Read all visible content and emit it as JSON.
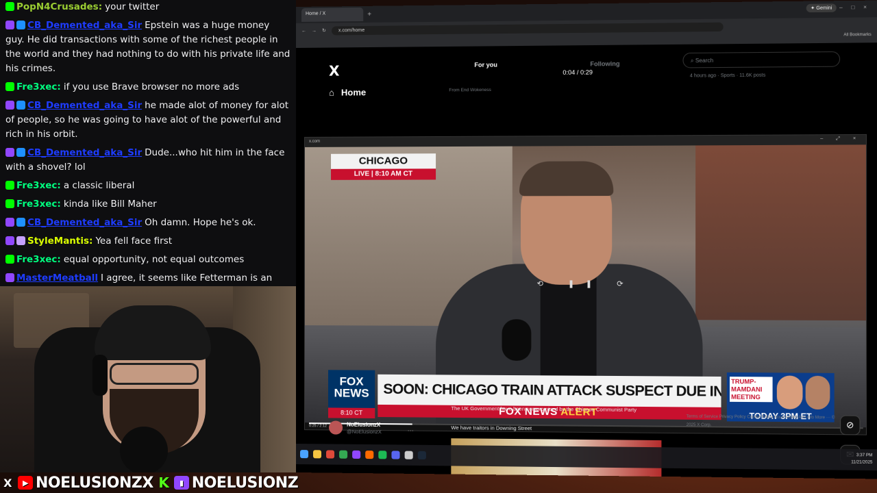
{
  "chat": {
    "messages": [
      {
        "user": "PopN4Crusades:",
        "color": "#9acd32",
        "badges": [
          "green"
        ],
        "text": "your twitter",
        "hidden": false
      },
      {
        "user": "CB_Demented_aka_Sir",
        "color": "#1e3cff",
        "badges": [
          "purple",
          "blue"
        ],
        "text": "Epstein was a huge money guy. He did transactions with some of the richest people in the world and they had nothing to do with his private life and his crimes.",
        "hidden": true
      },
      {
        "user": "Fre3xec:",
        "color": "#00ff7f",
        "badges": [
          "green"
        ],
        "text": "if you use Brave browser no more ads",
        "hidden": false
      },
      {
        "user": "CB_Demented_aka_Sir",
        "color": "#1e3cff",
        "badges": [
          "purple",
          "blue"
        ],
        "text": "he made alot of money for alot of people, so he was going to have alot of the powerful and rich in his orbit.",
        "hidden": true
      },
      {
        "user": "CB_Demented_aka_Sir",
        "color": "#1e3cff",
        "badges": [
          "purple",
          "blue"
        ],
        "text": "Dude...who hit him in the face with a shovel? lol",
        "hidden": true
      },
      {
        "user": "Fre3xec:",
        "color": "#00ff7f",
        "badges": [
          "green"
        ],
        "text": "a classic liberal",
        "hidden": false
      },
      {
        "user": "Fre3xec:",
        "color": "#00ff7f",
        "badges": [
          "green"
        ],
        "text": "kinda like Bill Maher",
        "hidden": false
      },
      {
        "user": "CB_Demented_aka_Sir",
        "color": "#1e3cff",
        "badges": [
          "purple",
          "blue"
        ],
        "text": "Oh damn. Hope he's ok.",
        "hidden": true
      },
      {
        "user": "StyleMantis:",
        "color": "#daff00",
        "badges": [
          "purple",
          "orange"
        ],
        "text": "Yea fell face first",
        "hidden": false
      },
      {
        "user": "Fre3xec:",
        "color": "#00ff7f",
        "badges": [
          "green"
        ],
        "text": "equal opportunity, not equal outcomes",
        "hidden": false
      },
      {
        "user": "MasterMeatball",
        "color": "#1e3cff",
        "badges": [
          "purple"
        ],
        "text": "I agree, it seems like Fetterman is an honest person. I wonder when he goes Republican.",
        "hidden": true
      }
    ]
  },
  "banner": {
    "x_icon": "X",
    "youtube_handle": "NOELUSIONZX",
    "kick_icon": "K",
    "twitch_handle": "NOELUSIONZ"
  },
  "browser": {
    "tab_title": "Home / X",
    "gemini_label": "Gemini",
    "url": "x.com/home",
    "bookmarks_label": "All Bookmarks"
  },
  "x": {
    "logo": "X",
    "home_label": "Home",
    "tab_for_you": "For you",
    "tab_following": "Following",
    "search_placeholder": "Search",
    "trend_meta": "4 hours ago · Sports · 11.6K posts",
    "video_timer": "0:04 / 0:29",
    "from_label": "From End Wokeness",
    "tweet_text": "The UK Government have been compromised by the Chinese Communist Party",
    "tweet_text2": "We have traitors in Downing Street",
    "account_name": "NoElusionzX",
    "account_handle": "@NoElusionzX",
    "footer": "Terms of Service   Privacy Policy   Cookie Policy   Accessibility   Ads info   More ···   © 2025 X Corp."
  },
  "player": {
    "title": "x.com",
    "city": "CHICAGO",
    "live_label": "LIVE | 8:10 AM CT",
    "fox_logo": "FOX NEWS",
    "fox_time": "8:10 CT",
    "headline": "SOON: CHICAGO TRAIN ATTACK SUSPECT DUE IN COURT",
    "alert_prefix": "FOX NEWS",
    "alert_word": "ALERT",
    "promo_title": "TRUMP-MAMDANI MEETING",
    "promo_time": "TODAY 3PM ET",
    "time": "0:25 / 2:12",
    "progress": 0.19
  },
  "taskbar": {
    "time": "3:37 PM",
    "date": "11/21/2025"
  }
}
